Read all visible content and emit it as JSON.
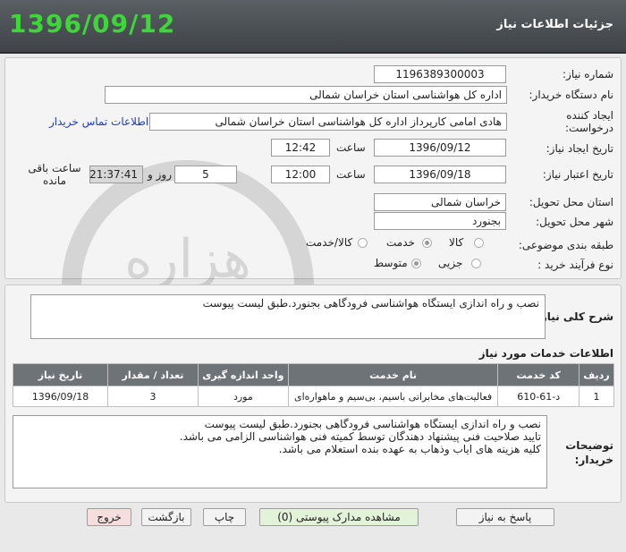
{
  "header": {
    "date": "1396/09/12",
    "title": "جزئیات اطلاعات نیاز"
  },
  "form": {
    "need_number_label": "شماره نیاز:",
    "need_number": "1196389300003",
    "buyer_label": "نام دستگاه خریدار:",
    "buyer": "اداره کل هواشناسی استان خراسان شمالی",
    "creator_label": "ایجاد کننده درخواست:",
    "creator": "هادی امامی کارپرداز اداره کل هواشناسی استان خراسان شمالی",
    "contact_link": "اطلاعات تماس خریدار",
    "created_date_label": "تاریخ ایجاد نیاز:",
    "created_date": "1396/09/12",
    "time_label": "ساعت",
    "created_time": "12:42",
    "validity_label": "تاریخ اعتبار نیاز:",
    "validity_date": "1396/09/18",
    "validity_time": "12:00",
    "days_value": "5",
    "days_label": "روز و",
    "remaining_time": "21:37:41",
    "remaining_label": "ساعت باقی مانده",
    "province_label": "استان محل تحویل:",
    "province": "خراسان شمالی",
    "city_label": "شهر محل تحویل:",
    "city": "بجنورد",
    "category_label": "طبقه بندی موضوعی:",
    "category_options": [
      "کالا",
      "خدمت",
      "کالا/خدمت"
    ],
    "process_label": "نوع فرآیند خرید :",
    "process_options": [
      "جزیی",
      "متوسط"
    ]
  },
  "summary": {
    "label": "شرح کلی نیاز:",
    "text": "نصب و راه اندازی ایستگاه هواشناسی فرودگاهی بجنورد.طبق لیست پیوست"
  },
  "services": {
    "title": "اطلاعات خدمات مورد نیاز",
    "columns": [
      "ردیف",
      "کد خدمت",
      "نام خدمت",
      "واحد اندازه گیری",
      "تعداد / مقدار",
      "تاریخ نیاز"
    ],
    "rows": [
      [
        "1",
        "د-61-610",
        "فعالیت‌های مخابراتی باسیم، بی‌سیم و ماهواره‌ای",
        "مورد",
        "3",
        "1396/09/18"
      ]
    ]
  },
  "buyer_notes": {
    "label": "توضیحات خریدار:",
    "lines": [
      "نصب و راه اندازی ایستگاه هواشناسی فرودگاهی بجنورد.طبق لیست پیوست",
      "تایید صلاحیت فنی پیشنهاد دهندگان توسط کمیته فنی هواشناسی الزامی می باشد.",
      "کلیه هزینه های ایاب وذهاب به عهده بنده استعلام می باشد."
    ]
  },
  "buttons": {
    "reply": "پاسخ به نیاز",
    "attachments": "مشاهده مدارک پیوستی (0)",
    "print": "چاپ",
    "back": "بازگشت",
    "exit": "خروج"
  },
  "watermark": {
    "text": "هزاره",
    "subtext": "ارتباط گستران"
  },
  "colors": {
    "header_bg": "#4a4f54",
    "date_green": "#3ed63a",
    "link_blue": "#1a3ccf",
    "table_header": "#6e7378"
  }
}
